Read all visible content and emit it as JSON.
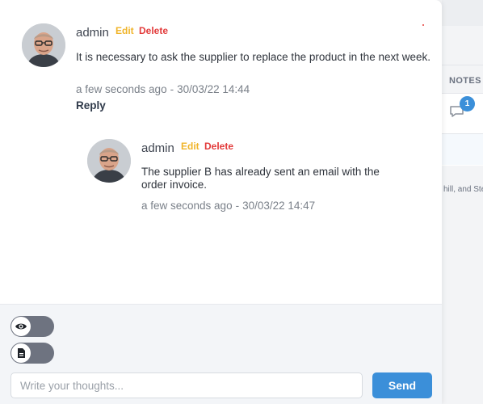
{
  "background": {
    "notes_header": "NOTES",
    "notes_badge_count": "1",
    "footer_text": "hill, and Ste"
  },
  "comments": [
    {
      "author": "admin",
      "edit_label": "Edit",
      "delete_label": "Delete",
      "text": "It is necessary to ask the supplier to replace the product in the next week.",
      "relative_time": "a few seconds ago",
      "separator": "-",
      "timestamp": "30/03/22 14:44",
      "reply_label": "Reply",
      "avatar_icon": "user-avatar-photo"
    },
    {
      "author": "admin",
      "edit_label": "Edit",
      "delete_label": "Delete",
      "text": "The supplier B has already sent an email with the order invoice.",
      "relative_time": "a few seconds ago",
      "separator": "-",
      "timestamp": "30/03/22 14:47",
      "avatar_icon": "user-avatar-photo"
    }
  ],
  "composer": {
    "visibility_toggle_icon": "eye-icon",
    "document_toggle_icon": "document-icon",
    "input_placeholder": "Write your thoughts...",
    "input_value": "",
    "send_label": "Send"
  },
  "colors": {
    "accent": "#3b8fd9",
    "edit": "#f0b429",
    "delete": "#e23a3a",
    "toggle": "#6e7380"
  }
}
